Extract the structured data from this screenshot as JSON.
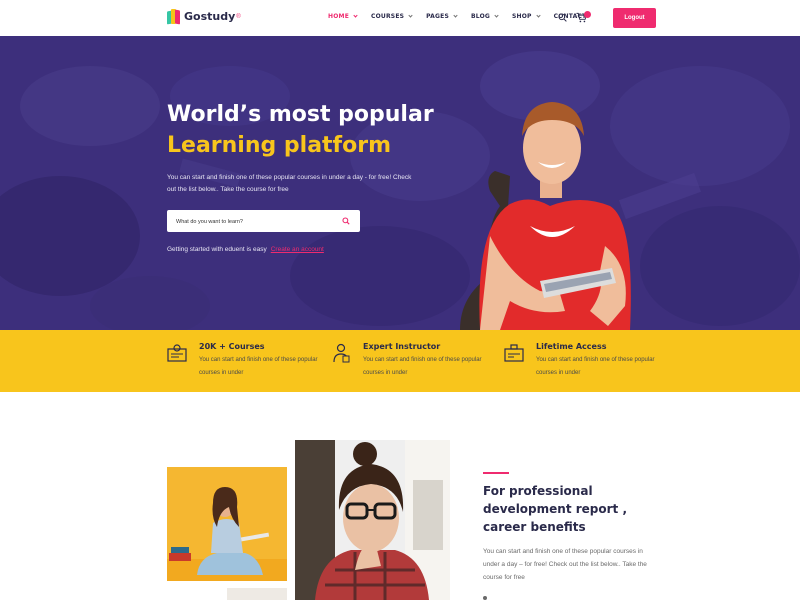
{
  "header": {
    "brand": "Gostudy",
    "brand_mark": "®",
    "nav": [
      {
        "label": "HOME",
        "active": true,
        "dropdown": true
      },
      {
        "label": "COURSES",
        "active": false,
        "dropdown": true
      },
      {
        "label": "PAGES",
        "active": false,
        "dropdown": true
      },
      {
        "label": "BLOG",
        "active": false,
        "dropdown": true
      },
      {
        "label": "SHOP",
        "active": false,
        "dropdown": true
      },
      {
        "label": "CONTACT",
        "active": false,
        "dropdown": false
      }
    ],
    "search_icon": "search-icon",
    "cart_icon": "cart-icon",
    "logout_label": "Logout"
  },
  "hero": {
    "title_line1": "World’s most popular",
    "title_line2": "Learning platform",
    "description": "You can start and finish one of these popular courses in under a day - for free! Check out the list below.. Take the course for free",
    "search_placeholder": "What do you want to learn?",
    "started_text": "Getting started with eduent is easy",
    "started_link": "Create an account"
  },
  "features": [
    {
      "title": "20K + Courses",
      "text": "You can start and finish one of these popular courses in under",
      "icon": "certificate-icon"
    },
    {
      "title": "Expert Instructor",
      "text": "You can start and finish one of these popular courses in under",
      "icon": "instructor-icon"
    },
    {
      "title": "Lifetime Access",
      "text": "You can start and finish one of these popular courses in under",
      "icon": "access-icon"
    }
  ],
  "about": {
    "title": "For professional development report , career benefits",
    "text": "You can start and finish one of these popular courses in under a day – for free! Check out the list below.. Take the course for free"
  },
  "colors": {
    "accent": "#ef2b6f",
    "hero_bg": "#3b2d78",
    "yellow": "#f8c51c",
    "navy_text": "#2a2a4a"
  }
}
